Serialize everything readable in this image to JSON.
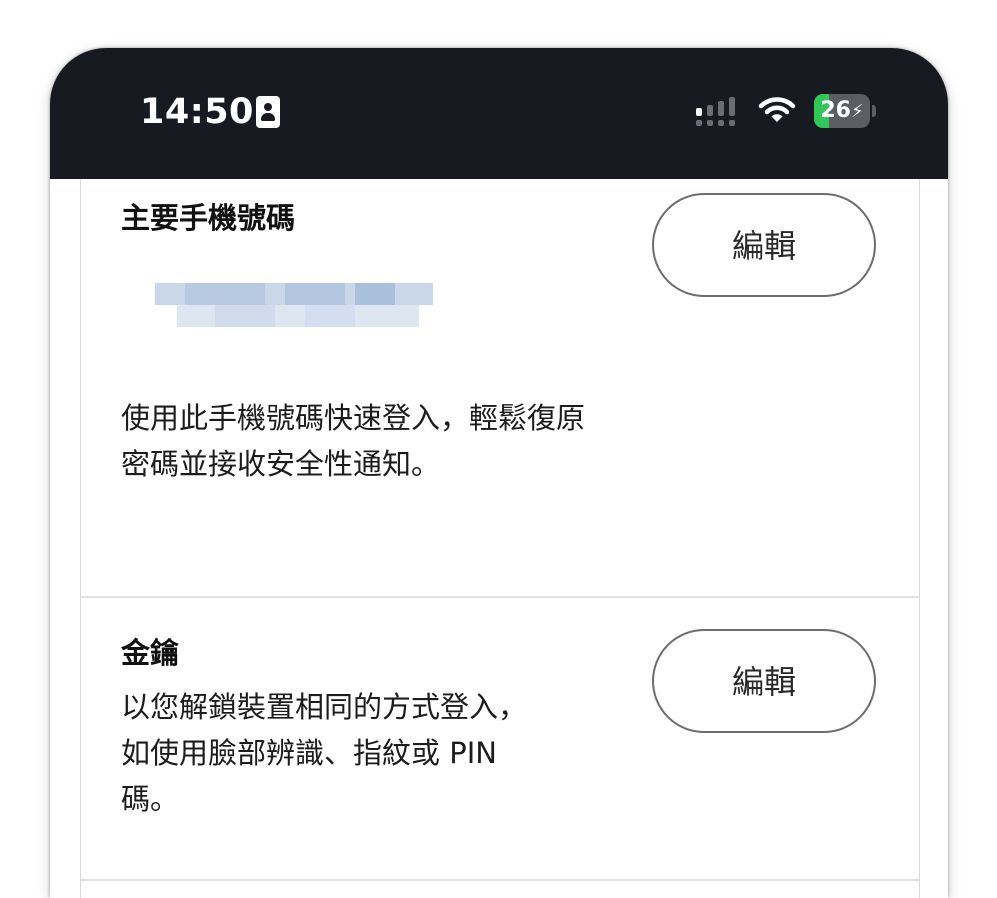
{
  "status_bar": {
    "time": "14:50",
    "battery_level": "26",
    "battery_fraction": 0.26,
    "icons": [
      "contact-card-icon",
      "signal-icon",
      "wifi-icon",
      "battery-charging-icon"
    ]
  },
  "sections": [
    {
      "title": "主要手機號碼",
      "value_redacted": true,
      "description_lines": [
        "使用此手機號碼快速登入，輕鬆復原",
        "密碼並接收安全性通知。"
      ],
      "button_label": "編輯"
    },
    {
      "title": "金鑰",
      "description_lines": [
        "以您解鎖裝置相同的方式登入，",
        "如使用臉部辨識、指紋或 PIN",
        "碼。"
      ],
      "button_label": "編輯"
    }
  ],
  "colors": {
    "status_bar_bg": "#171b21",
    "battery_green": "#33c759",
    "button_border": "#6d6d6d",
    "divider": "#e3e3e3"
  }
}
